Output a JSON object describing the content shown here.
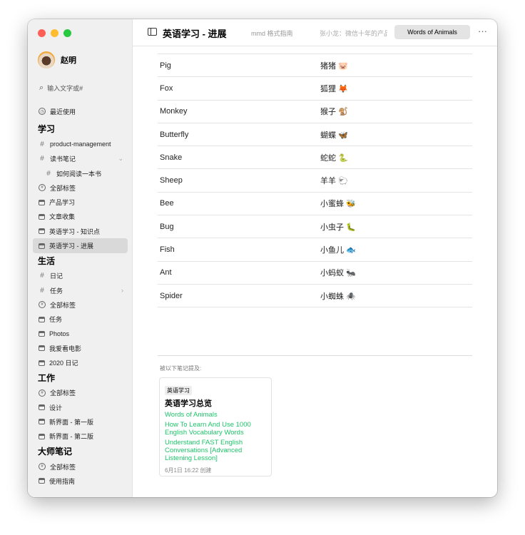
{
  "window": {
    "colors": {
      "close": "#fe5f57",
      "minimize": "#febc2e",
      "zoom": "#28c840",
      "link": "#1ec46a"
    }
  },
  "user": {
    "name": "赵明"
  },
  "search": {
    "placeholder": "输入文字或#"
  },
  "recent": "最近使用",
  "sections": [
    {
      "title": "学习",
      "items": [
        {
          "icon": "hash",
          "label": "product-management"
        },
        {
          "icon": "hash",
          "label": "读书笔记",
          "chevron": "down"
        },
        {
          "icon": "hash",
          "label": "如何阅读一本书",
          "sub": true
        },
        {
          "icon": "all-tags",
          "label": "全部标签"
        },
        {
          "icon": "tray",
          "label": "产品学习"
        },
        {
          "icon": "tray",
          "label": "文章收集"
        },
        {
          "icon": "tray",
          "label": "英语学习 -  知识点"
        },
        {
          "icon": "tray",
          "label": "英语学习 - 进展",
          "selected": true
        }
      ]
    },
    {
      "title": "生活",
      "items": [
        {
          "icon": "hash",
          "label": "日记"
        },
        {
          "icon": "hash",
          "label": "任务",
          "chevron": "right"
        },
        {
          "icon": "all-tags",
          "label": "全部标签"
        },
        {
          "icon": "tray",
          "label": "任务"
        },
        {
          "icon": "tray",
          "label": "Photos"
        },
        {
          "icon": "tray",
          "label": "我爱看电影"
        },
        {
          "icon": "tray",
          "label": "2020 日记"
        }
      ]
    },
    {
      "title": "工作",
      "items": [
        {
          "icon": "all-tags",
          "label": "全部标签"
        },
        {
          "icon": "tray",
          "label": "设计"
        },
        {
          "icon": "tray",
          "label": "新界面 - 第一版"
        },
        {
          "icon": "tray",
          "label": "新界面 - 第二版"
        }
      ]
    },
    {
      "title": "大师笔记",
      "items": [
        {
          "icon": "all-tags",
          "label": "全部标签"
        },
        {
          "icon": "tray",
          "label": "使用指南"
        }
      ]
    }
  ],
  "toolbar": {
    "title": "英语学习 - 进展",
    "tabs": [
      "mmd 格式指南",
      "张小龙：微信十年的产品思考",
      "Words of Animals"
    ],
    "more": "···"
  },
  "table": [
    [
      "Pig",
      "猪猪 🐷"
    ],
    [
      "Fox",
      "狐狸 🦊"
    ],
    [
      "Monkey",
      "猴子 🐒"
    ],
    [
      "Butterfly",
      "蝴蝶 🦋"
    ],
    [
      "Snake",
      "蛇蛇 🐍"
    ],
    [
      "Sheep",
      "羊羊 🐑"
    ],
    [
      "Bee",
      "小蜜蜂 🐝"
    ],
    [
      "Bug",
      "小虫子 🐛"
    ],
    [
      "Fish",
      "小鱼儿 🐟"
    ],
    [
      "Ant",
      "小蚂蚁 🐜"
    ],
    [
      "Spider",
      "小蜘蛛 🕷️"
    ]
  ],
  "backlinks": {
    "label": "被以下笔记提及:",
    "card": {
      "tag": "英语学习",
      "title": "英语学习总览",
      "links": [
        "Words of Animals",
        "How To Learn And Use 1000 English Vocabulary Words",
        "Understand FAST English Conversations [Advanced Listening Lesson]"
      ],
      "date": "6月1日 16:22 创建"
    }
  }
}
